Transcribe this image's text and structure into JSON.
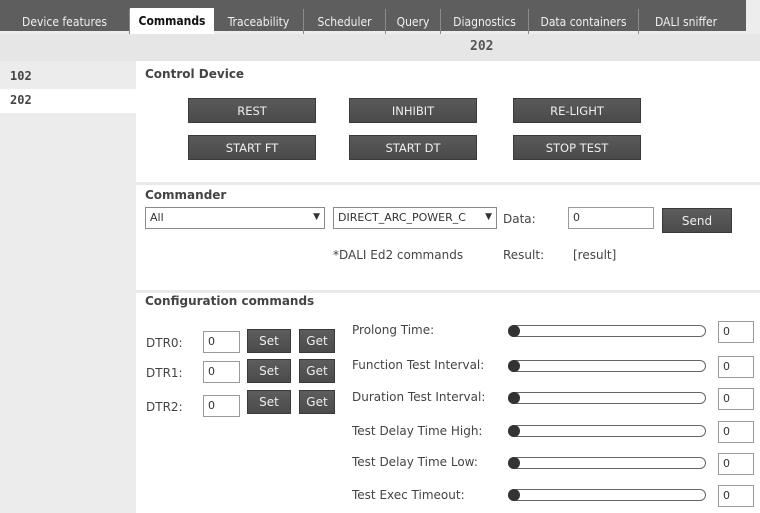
{
  "tabs": [
    {
      "label": "Device features",
      "active": false
    },
    {
      "label": "Commands",
      "active": true
    },
    {
      "label": "Traceability",
      "active": false
    },
    {
      "label": "Scheduler",
      "active": false
    },
    {
      "label": "Query",
      "active": false
    },
    {
      "label": "Diagnostics",
      "active": false
    },
    {
      "label": "Data containers",
      "active": false
    },
    {
      "label": "DALI sniffer",
      "active": false
    }
  ],
  "device_heading": "202",
  "sidebar": {
    "items": [
      {
        "label": "102",
        "selected": false
      },
      {
        "label": "202",
        "selected": true
      }
    ]
  },
  "control_device": {
    "title": "Control Device",
    "buttons": [
      "REST",
      "INHIBIT",
      "RE-LIGHT",
      "START FT",
      "START DT",
      "STOP TEST"
    ]
  },
  "commander": {
    "title": "Commander",
    "filter_value": "All",
    "command_value": "DIRECT_ARC_POWER_C",
    "data_label": "Data:",
    "data_value": "0",
    "send_label": "Send",
    "note": "*DALI Ed2 commands",
    "result_label": "Result:",
    "result_value": "[result]"
  },
  "configuration": {
    "title": "Configuration commands",
    "dtr": [
      {
        "label": "DTR0:",
        "value": "0"
      },
      {
        "label": "DTR1:",
        "value": "0"
      },
      {
        "label": "DTR2:",
        "value": "0"
      }
    ],
    "set_label": "Set",
    "get_label": "Get",
    "params": [
      {
        "label": "Prolong Time:",
        "value": "0"
      },
      {
        "label": "Function Test Interval:",
        "value": "0"
      },
      {
        "label": "Duration Test Interval:",
        "value": "0"
      },
      {
        "label": "Test Delay Time High:",
        "value": "0"
      },
      {
        "label": "Test Delay Time Low:",
        "value": "0"
      },
      {
        "label": "Test Exec Timeout:",
        "value": "0"
      }
    ]
  },
  "icons": {
    "dropdown": "chevron-down-icon"
  }
}
